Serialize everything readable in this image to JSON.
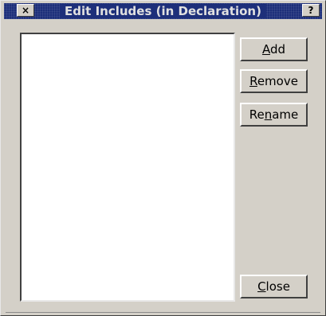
{
  "window": {
    "title": "Edit Includes (in Declaration)",
    "close_glyph": "×",
    "help_glyph": "?"
  },
  "list": {
    "items": []
  },
  "buttons": {
    "add": {
      "pre": "",
      "mnemonic": "A",
      "post": "dd"
    },
    "remove": {
      "pre": "",
      "mnemonic": "R",
      "post": "emove"
    },
    "rename": {
      "pre": "Re",
      "mnemonic": "n",
      "post": "ame"
    },
    "close": {
      "pre": "",
      "mnemonic": "C",
      "post": "lose"
    }
  }
}
